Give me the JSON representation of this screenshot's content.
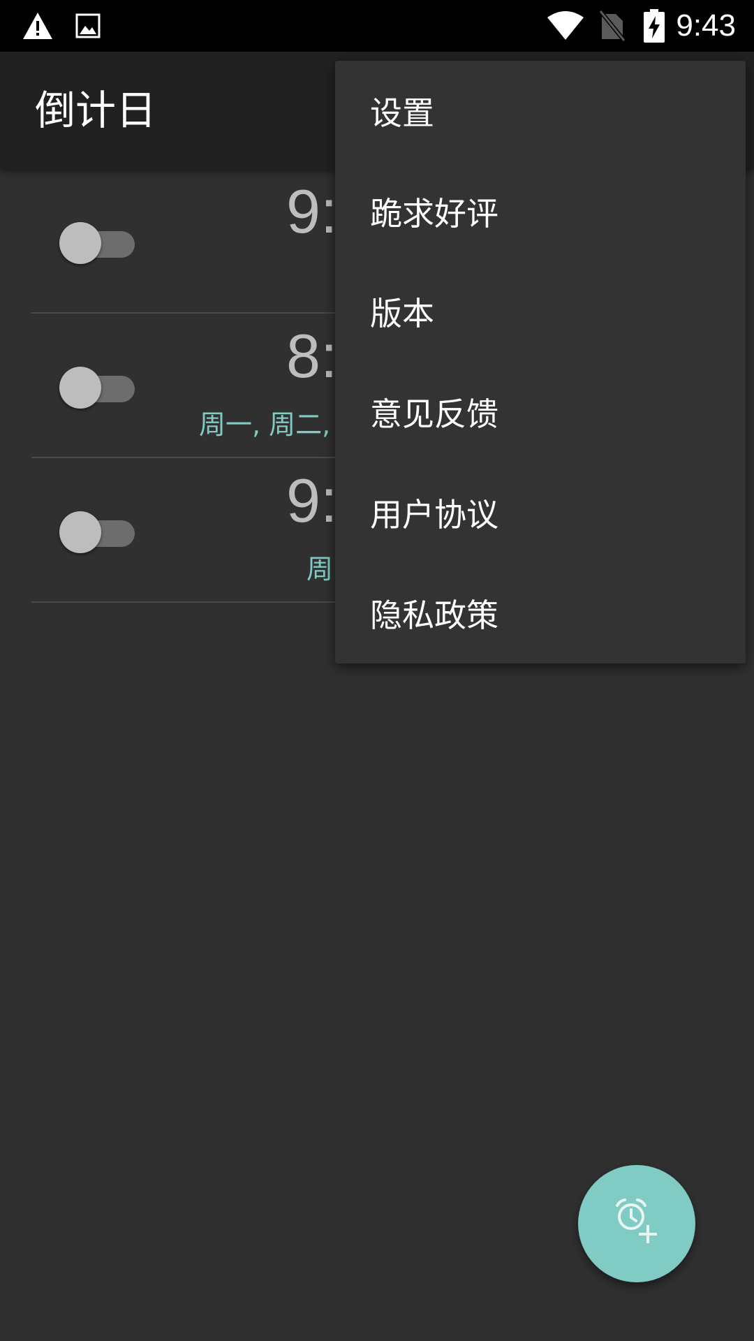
{
  "status_bar": {
    "time": "9:43",
    "icons": [
      "warning-icon",
      "image-icon",
      "wifi-icon",
      "no-sim-icon",
      "battery-charging-icon"
    ]
  },
  "app_bar": {
    "title": "倒计日"
  },
  "alarms": [
    {
      "time": "9:",
      "days": "",
      "enabled": false
    },
    {
      "time": "8:",
      "days": "周一, 周二,",
      "enabled": false
    },
    {
      "time": "9:",
      "days": "周",
      "enabled": false
    }
  ],
  "menu": {
    "items": [
      {
        "label": "设置"
      },
      {
        "label": "跪求好评"
      },
      {
        "label": "版本"
      },
      {
        "label": "意见反馈"
      },
      {
        "label": "用户协议"
      },
      {
        "label": "隐私政策"
      }
    ]
  },
  "fab": {
    "icon": "add-alarm-icon"
  },
  "colors": {
    "background": "#303030",
    "app_bar": "#212121",
    "accent": "#80cbc4",
    "menu": "#333333",
    "divider": "#4a4a4a"
  }
}
